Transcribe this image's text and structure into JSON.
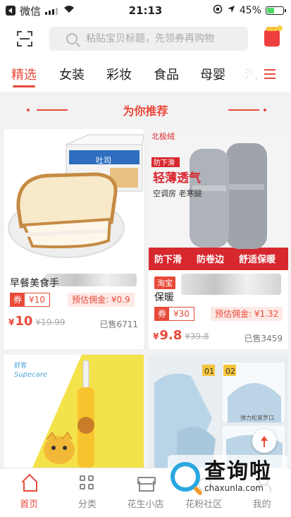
{
  "status_bar": {
    "carrier": "微信",
    "wifi_icon": "wifi-icon",
    "time": "21:13",
    "battery_percent": "45%",
    "battery_level": 0.45
  },
  "header": {
    "search_placeholder": "粘贴宝贝标题，先领券再购物"
  },
  "tabs": [
    "精选",
    "女装",
    "彩妆",
    "食品",
    "母婴",
    "汽"
  ],
  "section": {
    "title": "为你推荐"
  },
  "products": [
    {
      "name": "早餐美食手",
      "coupon_label": "券",
      "coupon_value": "¥10",
      "commission": "预估佣金: ¥0.9",
      "price_symbol": "¥",
      "price": "10",
      "old_price": "¥19.99",
      "sold": "已售6711"
    },
    {
      "tag": "淘宝",
      "name": "保暖",
      "coupon_label": "券",
      "coupon_value": "¥30",
      "commission": "预估佣金: ¥1.32",
      "price_symbol": "¥",
      "price": "9.8",
      "old_price": "¥39.8",
      "sold": "已售3459",
      "banner": {
        "brand": "北极绒",
        "slogan": "防下滑",
        "headline": "轻薄透气",
        "sub": "空调房 老寒腿",
        "features": [
          "防下滑",
          "防卷边",
          "舒适保暖"
        ]
      }
    }
  ],
  "bread_box": {
    "brand_text": "吐司"
  },
  "toothbrush": {
    "brand": "Supecare",
    "brand_cn": "舒客"
  },
  "sweater": {
    "labels": [
      "01",
      "02"
    ],
    "caption": "弹力松紧罗口"
  },
  "bottom_nav": [
    {
      "label": "首页",
      "icon": "home-icon"
    },
    {
      "label": "分类",
      "icon": "grid-icon"
    },
    {
      "label": "花生小店",
      "icon": "shop-icon"
    },
    {
      "label": "花粉社区",
      "icon": "community-icon"
    },
    {
      "label": "我的",
      "icon": "profile-icon"
    }
  ],
  "watermark": {
    "text": "查询啦",
    "url": "chaxunla.com"
  },
  "colors": {
    "accent": "#e84a3a",
    "background": "#f2f2f2"
  }
}
